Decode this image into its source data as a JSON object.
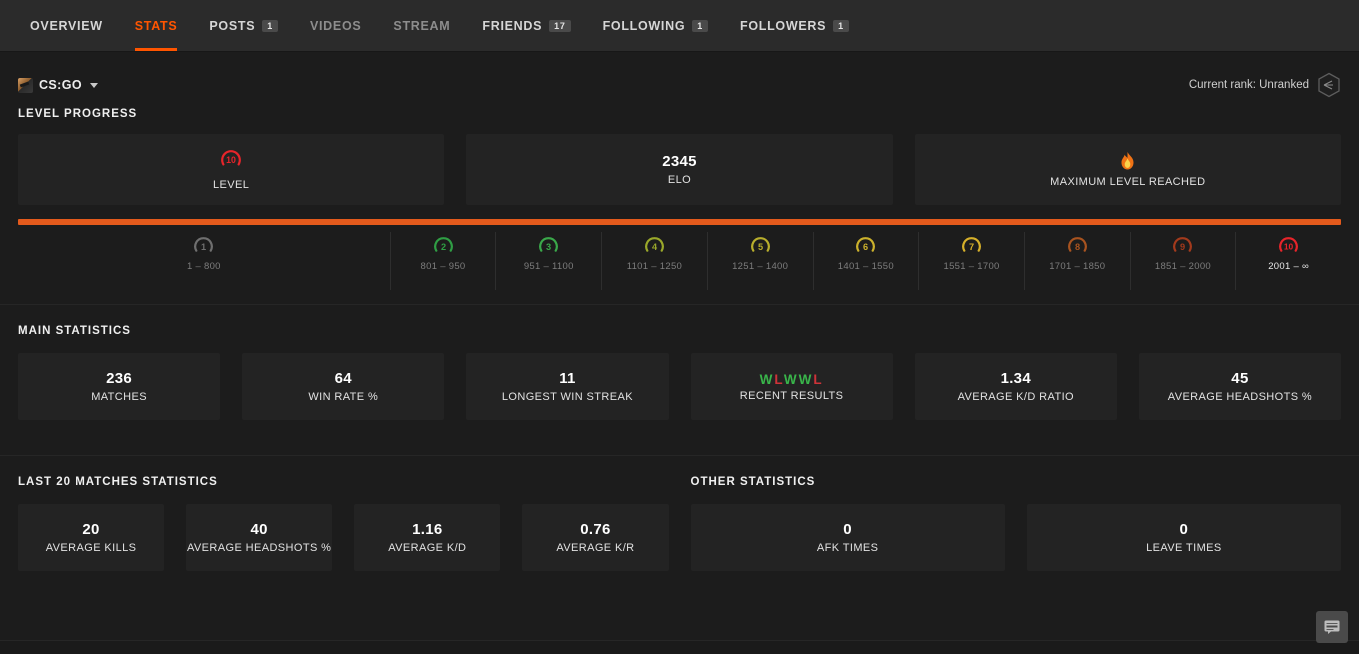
{
  "nav": {
    "tabs": [
      {
        "label": "OVERVIEW",
        "badge": null,
        "active": false,
        "dim": false
      },
      {
        "label": "STATS",
        "badge": null,
        "active": true,
        "dim": false
      },
      {
        "label": "POSTS",
        "badge": "1",
        "active": false,
        "dim": false
      },
      {
        "label": "VIDEOS",
        "badge": null,
        "active": false,
        "dim": true
      },
      {
        "label": "STREAM",
        "badge": null,
        "active": false,
        "dim": true
      },
      {
        "label": "FRIENDS",
        "badge": "17",
        "active": false,
        "dim": false
      },
      {
        "label": "FOLLOWING",
        "badge": "1",
        "active": false,
        "dim": false
      },
      {
        "label": "FOLLOWERS",
        "badge": "1",
        "active": false,
        "dim": false
      }
    ]
  },
  "gamebar": {
    "game": "CS:GO",
    "game_icon": "csgo-icon",
    "caret_icon": "chevron-down-icon",
    "rank_text": "Current rank: Unranked",
    "rank_icon": "rank-hex-icon"
  },
  "level_progress": {
    "heading": "LEVEL PROGRESS",
    "cards": [
      {
        "kind": "level",
        "badge": "10",
        "label": "LEVEL"
      },
      {
        "kind": "value",
        "value": "2345",
        "label": "ELO"
      },
      {
        "kind": "flame",
        "icon": "flame-icon",
        "label": "MAXIMUM LEVEL REACHED"
      }
    ],
    "bar": {
      "fill_percent": 100,
      "fill_color": "#e35a1c",
      "track_color": "#3a1608"
    },
    "levels": [
      {
        "n": "1",
        "range": "1 – 800",
        "color": "#6f6f6f",
        "current": false
      },
      {
        "n": "2",
        "range": "801 – 950",
        "color": "#2f9e44",
        "current": false
      },
      {
        "n": "3",
        "range": "951 – 1100",
        "color": "#3aa84a",
        "current": false
      },
      {
        "n": "4",
        "range": "1101 – 1250",
        "color": "#9aa82a",
        "current": false
      },
      {
        "n": "5",
        "range": "1251 – 1400",
        "color": "#b8ae2c",
        "current": false
      },
      {
        "n": "6",
        "range": "1401 – 1550",
        "color": "#cbb12c",
        "current": false
      },
      {
        "n": "7",
        "range": "1551 – 1700",
        "color": "#d6b02a",
        "current": false
      },
      {
        "n": "8",
        "range": "1701 – 1850",
        "color": "#a8531f",
        "current": false
      },
      {
        "n": "9",
        "range": "1851 – 2000",
        "color": "#a33a1c",
        "current": false
      },
      {
        "n": "10",
        "range": "2001 – ∞",
        "color": "#e8242a",
        "current": true
      }
    ]
  },
  "main_statistics": {
    "heading": "MAIN STATISTICS",
    "cards": [
      {
        "kind": "value",
        "value": "236",
        "label": "MATCHES"
      },
      {
        "kind": "value",
        "value": "64",
        "label": "WIN RATE %"
      },
      {
        "kind": "value",
        "value": "11",
        "label": "LONGEST WIN STREAK"
      },
      {
        "kind": "results",
        "results": [
          "W",
          "L",
          "W",
          "W",
          "L"
        ],
        "label": "RECENT RESULTS"
      },
      {
        "kind": "value",
        "value": "1.34",
        "label": "AVERAGE K/D RATIO"
      },
      {
        "kind": "value",
        "value": "45",
        "label": "AVERAGE HEADSHOTS %"
      }
    ],
    "win_color": "#39b54a",
    "loss_color": "#cf3338"
  },
  "last20": {
    "heading": "LAST 20 MATCHES STATISTICS",
    "cards": [
      {
        "value": "20",
        "label": "AVERAGE KILLS"
      },
      {
        "value": "40",
        "label": "AVERAGE HEADSHOTS %"
      },
      {
        "value": "1.16",
        "label": "AVERAGE K/D"
      },
      {
        "value": "0.76",
        "label": "AVERAGE K/R"
      }
    ]
  },
  "other": {
    "heading": "OTHER STATISTICS",
    "cards": [
      {
        "value": "0",
        "label": "AFK TIMES"
      },
      {
        "value": "0",
        "label": "LEAVE TIMES"
      }
    ]
  },
  "chat": {
    "icon": "chat-icon"
  },
  "theme": {
    "accent": "#ff5500",
    "bg": "#1c1c1c",
    "card_bg": "#232323",
    "nav_bg": "#2b2b2b"
  }
}
